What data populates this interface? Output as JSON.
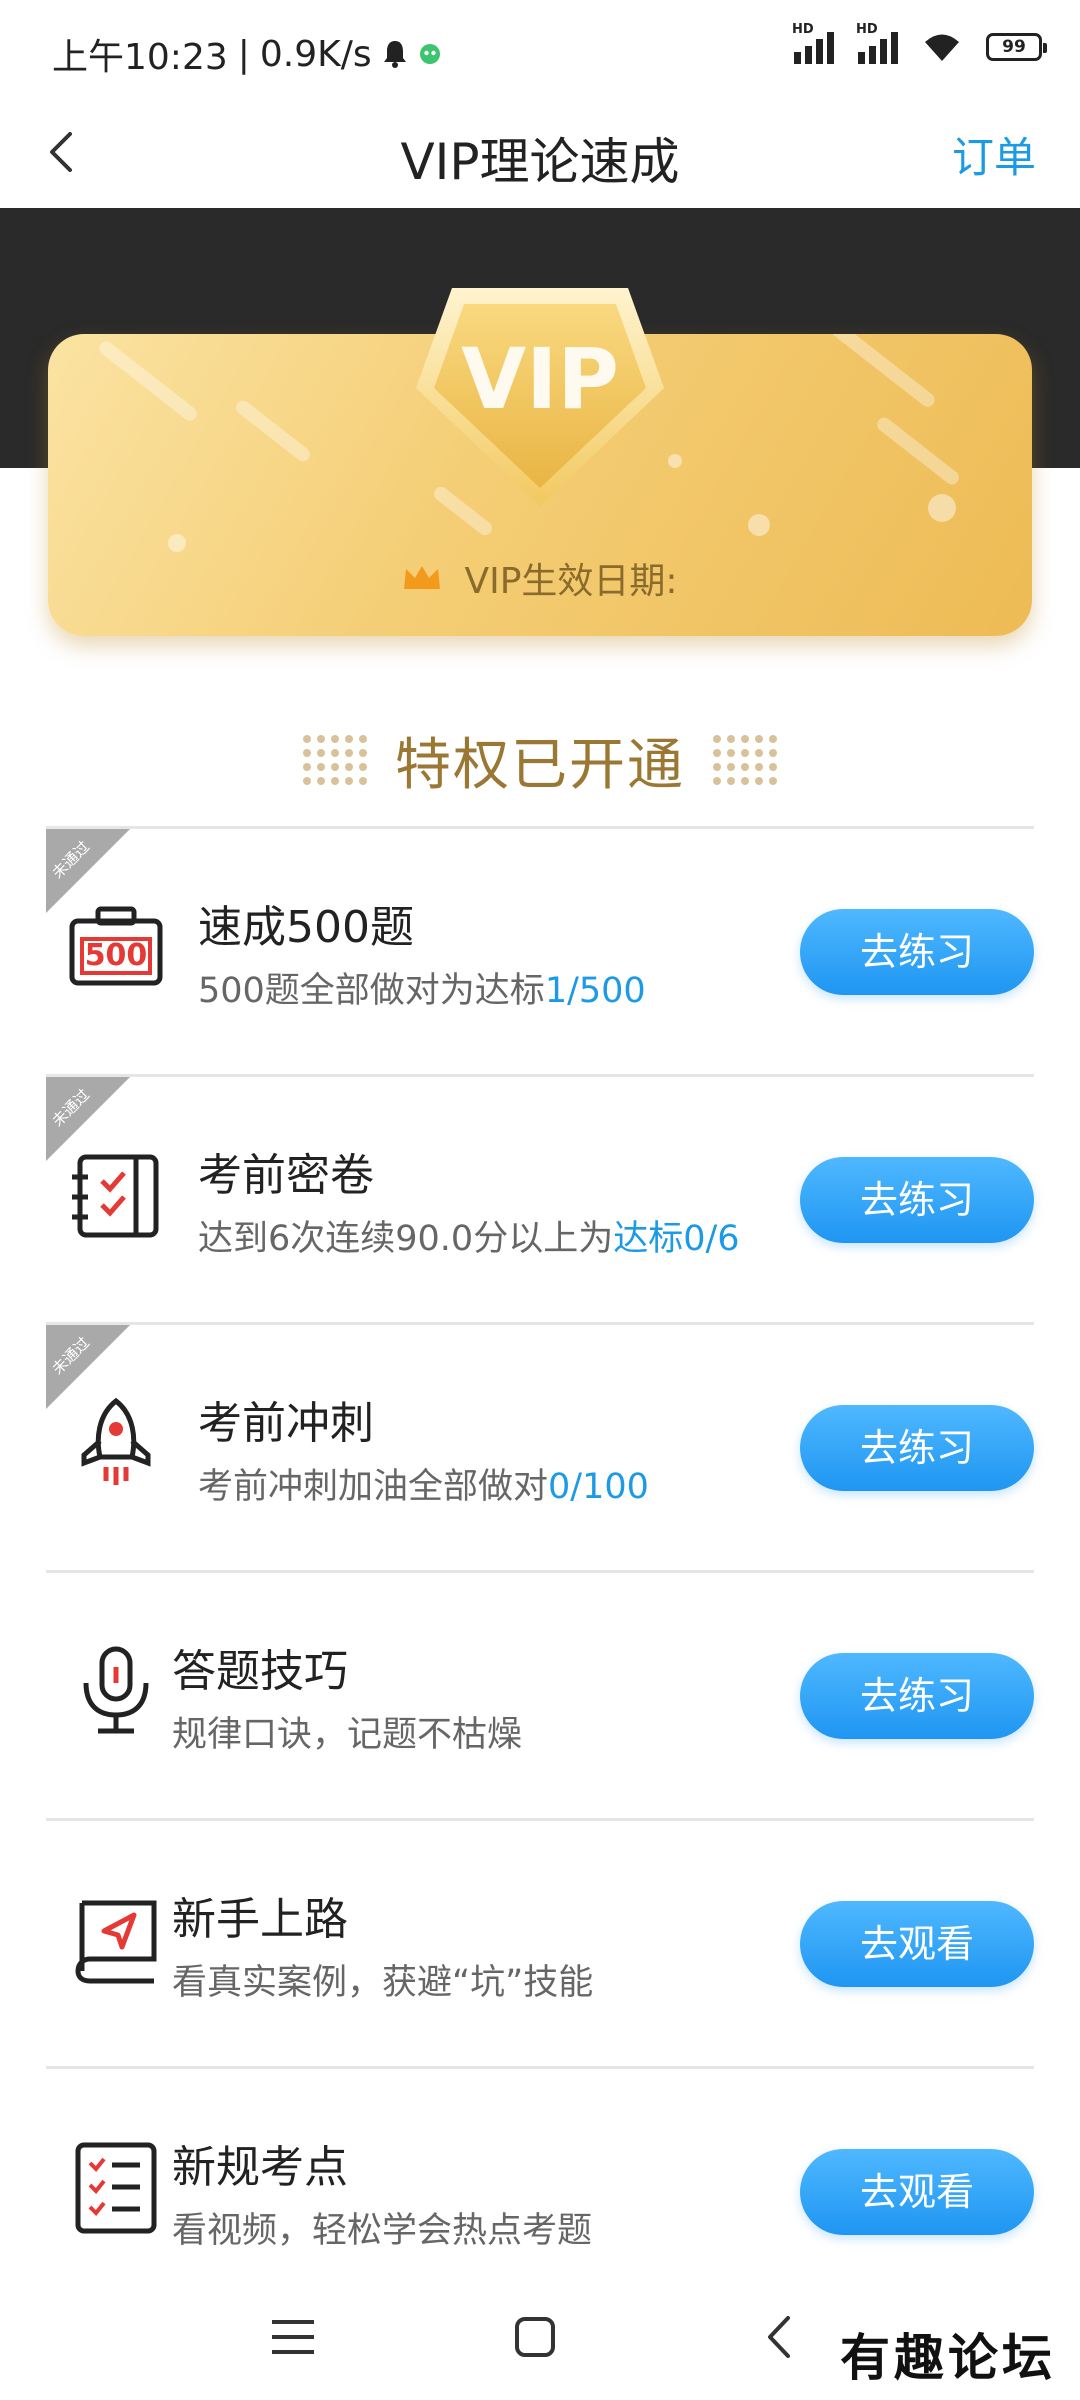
{
  "status_bar": {
    "time": "上午10:23",
    "net_speed": "0.9K/s",
    "battery": "99"
  },
  "nav": {
    "title": "VIP理论速成",
    "action": "订单"
  },
  "vip_card": {
    "badge_text": "VIP",
    "date_label": "VIP生效日期:"
  },
  "section": {
    "title": "特权已开通"
  },
  "items": [
    {
      "title": "速成500题",
      "subtitle": "500题全部做对为达标",
      "progress": "1/500",
      "button": "去练习",
      "corner_tag": "未通过",
      "icon_text": "500"
    },
    {
      "title": "考前密卷",
      "subtitle": "达到6次连续90.0分以上为",
      "progress": "达标0/6",
      "button": "去练习",
      "corner_tag": "未通过"
    },
    {
      "title": "考前冲刺",
      "subtitle": "考前冲刺加油全部做对",
      "progress": "0/100",
      "button": "去练习",
      "corner_tag": "未通过"
    },
    {
      "title": "答题技巧",
      "subtitle": "规律口诀，记题不枯燥",
      "button": "去练习"
    },
    {
      "title": "新手上路",
      "subtitle": "看真实案例，获避“坑”技能",
      "button": "去观看"
    },
    {
      "title": "新规考点",
      "subtitle": "看视频，轻松学会热点考题",
      "button": "去观看"
    }
  ],
  "watermark": "有趣论坛",
  "colors": {
    "accent": "#1c9ae6",
    "gold": "#9a7732",
    "dark_header": "#2a2a2a"
  }
}
